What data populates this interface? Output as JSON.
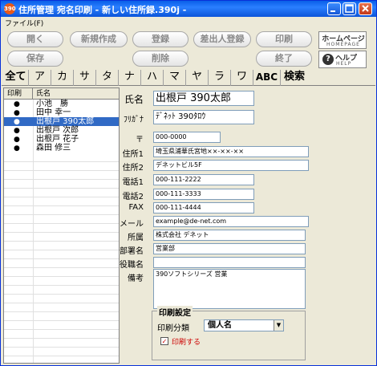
{
  "window": {
    "icon": "390",
    "title": "住所管理 宛名印刷 - 新しい住所録.390j -"
  },
  "menu": {
    "file": "ファイル(F)"
  },
  "toolbar": {
    "open": "開く",
    "new": "新規作成",
    "register": "登録",
    "sender_register": "差出人登録",
    "print": "印刷",
    "save": "保存",
    "delete": "削除",
    "exit": "終了",
    "homepage": {
      "main": "ホームページ",
      "sub": "HOMEPAGE"
    },
    "help": {
      "mark": "?",
      "main": "ヘルプ",
      "sub": "HELP"
    }
  },
  "tabs": [
    "全て",
    "ア",
    "カ",
    "サ",
    "タ",
    "ナ",
    "ハ",
    "マ",
    "ヤ",
    "ラ",
    "ワ",
    "ABC",
    "検索"
  ],
  "list": {
    "header_print": "印刷",
    "header_name": "氏名",
    "rows": [
      {
        "mark": "●",
        "name": "小池　勝"
      },
      {
        "mark": "●",
        "name": "田中 幸一"
      },
      {
        "mark": "●",
        "name": "出根戸 390太郎"
      },
      {
        "mark": "●",
        "name": "出根戸 次郎"
      },
      {
        "mark": "●",
        "name": "出根戸 花子"
      },
      {
        "mark": "●",
        "name": "森田 修三"
      }
    ]
  },
  "form": {
    "labels": {
      "name": "氏名",
      "kana": "ﾌﾘｶﾞﾅ",
      "zip": "〒",
      "address1": "住所1",
      "address2": "住所2",
      "phone1": "電話1",
      "phone2": "電話2",
      "fax": "FAX",
      "mail": "メール",
      "company": "所属",
      "department": "部署名",
      "title": "役職名",
      "note": "備考"
    },
    "values": {
      "name": "出根戸 390太郎",
      "kana": "ﾃﾞﾈｯﾄ 390ﾀﾛｳ",
      "zip": "000-0000",
      "address1": "埼玉県浦華氏宮地××-××-××",
      "address2": "デネットビル5F",
      "phone1": "000-111-2222",
      "phone2": "000-111-3333",
      "fax": "000-111-4444",
      "mail": "example@de-net.com",
      "company": "株式会社 デネット",
      "department": "営業部",
      "title": "",
      "note": "390ソフトシリーズ 営業"
    }
  },
  "print_settings": {
    "title": "印刷設定",
    "category_label": "印刷分類",
    "category_value": "個人名",
    "checkbox_mark": "✓",
    "checkbox_label": "印刷する"
  }
}
